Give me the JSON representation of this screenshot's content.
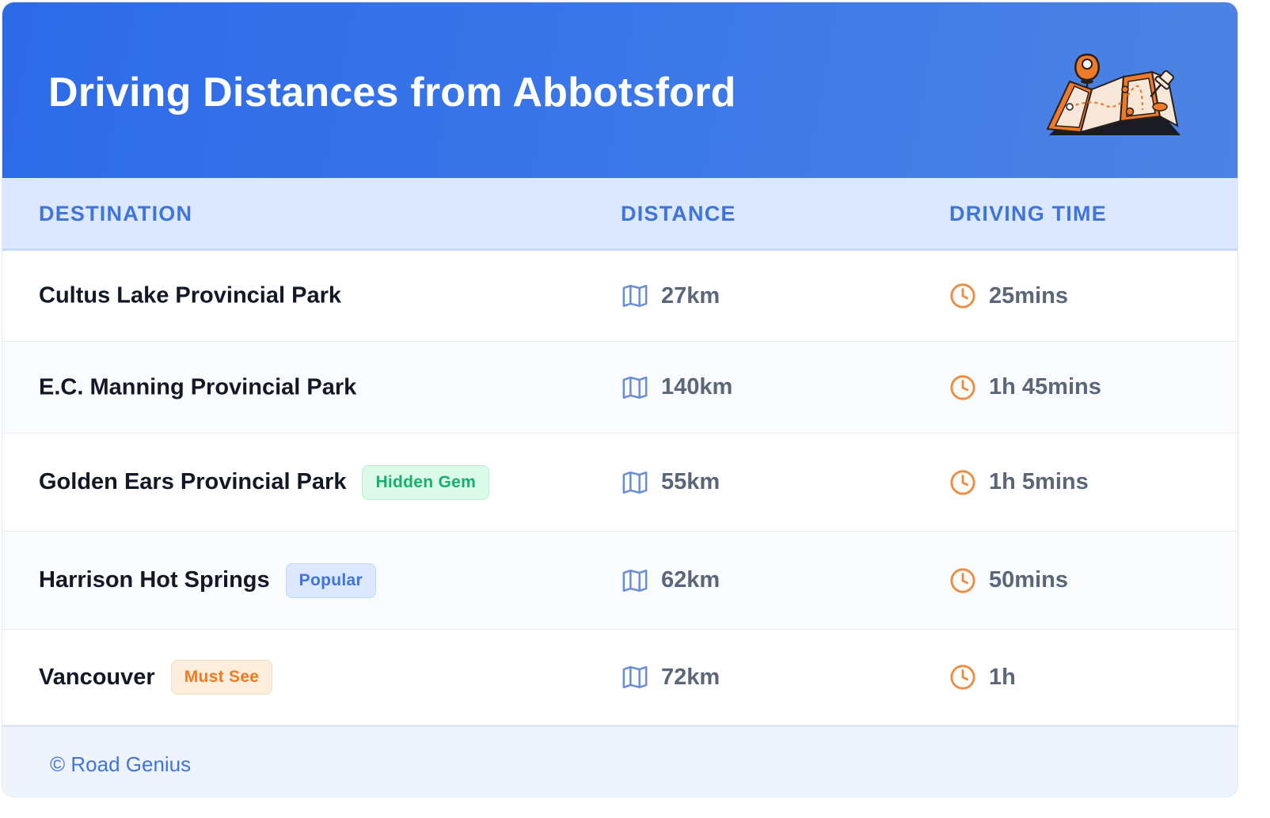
{
  "header": {
    "title": "Driving Distances from Abbotsford",
    "illustration_icon": "map-pin-illustration-icon"
  },
  "table": {
    "columns": [
      "DESTINATION",
      "DISTANCE",
      "DRIVING TIME"
    ],
    "rows": [
      {
        "destination": "Cultus Lake Provincial Park",
        "badge": null,
        "distance": "27km",
        "time": "25mins"
      },
      {
        "destination": "E.C. Manning Provincial Park",
        "badge": null,
        "distance": "140km",
        "time": "1h 45mins"
      },
      {
        "destination": "Golden Ears Provincial Park",
        "badge": "Hidden Gem",
        "distance": "55km",
        "time": "1h 5mins"
      },
      {
        "destination": "Harrison Hot Springs",
        "badge": "Popular",
        "distance": "62km",
        "time": "50mins"
      },
      {
        "destination": "Vancouver",
        "badge": "Must See",
        "distance": "72km",
        "time": "1h"
      }
    ],
    "distance_icon": "map-icon",
    "time_icon": "clock-icon"
  },
  "footer": {
    "text": "© Road Genius"
  },
  "colors": {
    "header_gradient_start": "#2d6ae8",
    "header_gradient_end": "#4d83e3",
    "accent_blue": "#3f74dd",
    "clock_orange": "#f08a3c",
    "badge_hidden_gem": "#15b06a",
    "badge_popular": "#3f74dd",
    "badge_must_see": "#f07a22"
  }
}
